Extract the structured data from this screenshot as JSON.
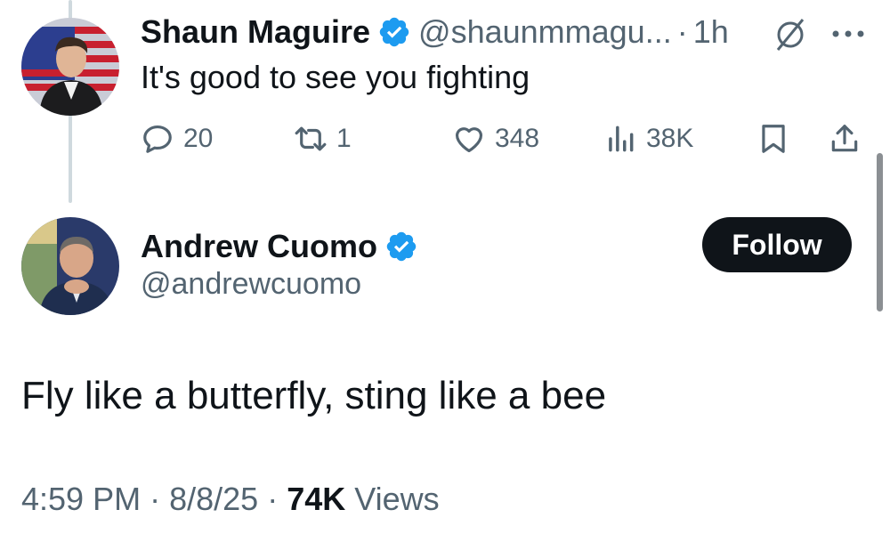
{
  "reply": {
    "author_name": "Shaun Maguire",
    "handle": "@shaunmmagu...",
    "separator": "·",
    "time": "1h",
    "text": "It's good to see you fighting",
    "replies": "20",
    "reposts": "1",
    "likes": "348",
    "views": "38K"
  },
  "tweet": {
    "author_name": "Andrew Cuomo",
    "handle": "@andrewcuomo",
    "follow_label": "Follow",
    "text": "Fly like a butterfly, sting like a bee",
    "time": "4:59 PM",
    "sep1": "·",
    "date": "8/8/25",
    "sep2": "·",
    "views_count": "74K",
    "views_label": "Views"
  },
  "colors": {
    "verified": "#1d9bf0",
    "secondary_text": "#536471",
    "primary_text": "#0f1419",
    "follow_bg": "#0f1419"
  },
  "icons": [
    "verified-badge-icon",
    "grok-icon",
    "more-icon",
    "reply-icon",
    "repost-icon",
    "like-icon",
    "views-icon",
    "bookmark-icon",
    "share-icon"
  ]
}
